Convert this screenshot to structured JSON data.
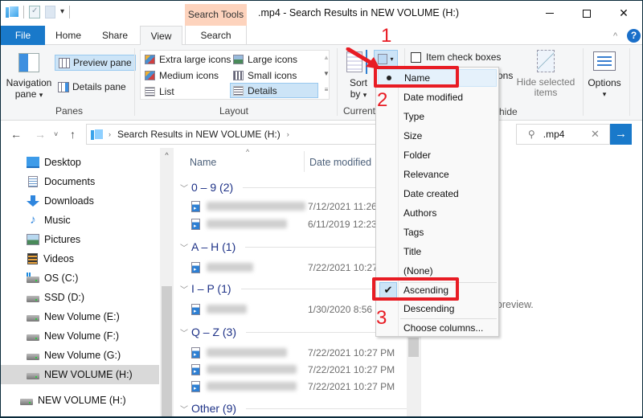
{
  "window": {
    "title": ".mp4 - Search Results in NEW VOLUME (H:)",
    "contextual_tab_group": "Search Tools"
  },
  "ribbon_tabs": [
    "File",
    "Home",
    "Share",
    "View",
    "Search"
  ],
  "active_tab": "View",
  "ribbon": {
    "panes": {
      "group_label": "Panes",
      "navigation_pane": "Navigation pane",
      "navigation_pane_line1": "Navigation",
      "navigation_pane_line2": "pane",
      "preview_pane": "Preview pane",
      "details_pane": "Details pane"
    },
    "layout": {
      "group_label": "Layout",
      "items": [
        "Extra large icons",
        "Large icons",
        "Medium icons",
        "Small icons",
        "List",
        "Details"
      ],
      "selected": "Details"
    },
    "current_view": {
      "group_label_partial": "Current",
      "sort_by_line1": "Sort",
      "sort_by_line2": "by"
    },
    "show_hide": {
      "item_check_boxes": "Item check boxes",
      "item_check_boxes_checked": false,
      "partial_label_1": "ons",
      "group_label_partial": "hide",
      "hide_selected_items_line1": "Hide selected",
      "hide_selected_items_line2": "items"
    },
    "options_label": "Options"
  },
  "address_bar": {
    "path": "Search Results in NEW VOLUME (H:)"
  },
  "search": {
    "value": ".mp4"
  },
  "nav_pane": {
    "items": [
      {
        "label": "Desktop",
        "icon": "desktop-icon"
      },
      {
        "label": "Documents",
        "icon": "documents-icon"
      },
      {
        "label": "Downloads",
        "icon": "downloads-icon"
      },
      {
        "label": "Music",
        "icon": "music-icon"
      },
      {
        "label": "Pictures",
        "icon": "pictures-icon"
      },
      {
        "label": "Videos",
        "icon": "videos-icon"
      },
      {
        "label": "OS (C:)",
        "icon": "os-drive-icon"
      },
      {
        "label": "SSD (D:)",
        "icon": "drive-icon"
      },
      {
        "label": "New Volume (E:)",
        "icon": "drive-icon"
      },
      {
        "label": "New Volume (F:)",
        "icon": "drive-icon"
      },
      {
        "label": "New Volume (G:)",
        "icon": "drive-icon"
      },
      {
        "label": "NEW VOLUME (H:)",
        "icon": "drive-icon",
        "selected": true
      },
      {
        "label": "NEW VOLUME (H:)",
        "icon": "drive-icon"
      }
    ]
  },
  "file_list": {
    "columns": [
      "Name",
      "Date modified"
    ],
    "groups": [
      {
        "label": "0 – 9 (2)",
        "files": [
          {
            "name": "[blurred]",
            "date": "7/12/2021 11:26"
          },
          {
            "name": "[blurred]",
            "date": "6/11/2019 12:23"
          }
        ]
      },
      {
        "label": "A – H (1)",
        "files": [
          {
            "name": "[blurred]",
            "date": "7/22/2021 10:27"
          }
        ]
      },
      {
        "label": "I – P (1)",
        "files": [
          {
            "name": "[blurred]",
            "date": "1/30/2020 8:56 P"
          }
        ]
      },
      {
        "label": "Q – Z (3)",
        "files": [
          {
            "name": "[blurred]",
            "date": "7/22/2021 10:27 PM"
          },
          {
            "name": "[blurred]",
            "date": "7/22/2021 10:27 PM"
          },
          {
            "name": "[blurred]",
            "date": "7/22/2021 10:27 PM"
          }
        ]
      },
      {
        "label": "Other (9)",
        "files": []
      }
    ]
  },
  "preview_pane": {
    "message_partial": "ect a file to preview."
  },
  "group_by_menu": {
    "items": [
      "Name",
      "Date modified",
      "Type",
      "Size",
      "Folder",
      "Relevance",
      "Date created",
      "Authors",
      "Tags",
      "Title",
      "(None)"
    ],
    "selected_item": "Name",
    "order_items": [
      "Ascending",
      "Descending"
    ],
    "selected_order": "Ascending",
    "footer": "Choose columns..."
  },
  "annotations": {
    "step1": "1",
    "step2": "2",
    "step3": "3",
    "color": "#e81c24"
  },
  "colors": {
    "accent": "#1979ca",
    "contextual_tab": "#fdd3bd",
    "selection": "#cce4f7",
    "group_header": "#1e3287"
  },
  "glyphs": {
    "minimize": "",
    "close": "✕",
    "help": "?",
    "collapse": "^",
    "back": "←",
    "forward": "→",
    "recent": "˅",
    "up": "↑",
    "crumb_sep": "›",
    "search": "⌕",
    "clear": "✕",
    "go": "→",
    "dropdown": "▾",
    "chevron": "⌄",
    "check": "✔",
    "scroll_up": "^"
  }
}
